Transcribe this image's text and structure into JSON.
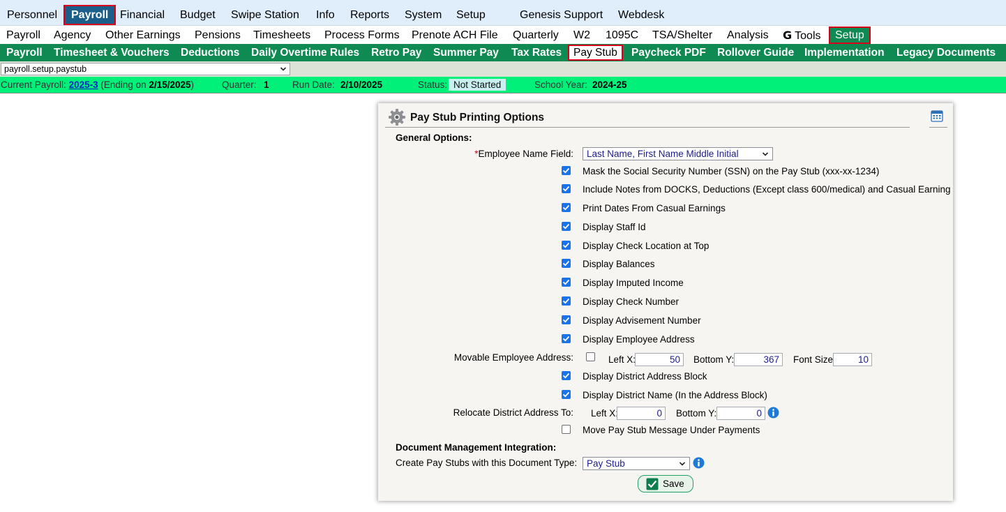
{
  "top_menu": {
    "items": [
      "Personnel",
      "Payroll",
      "Financial",
      "Budget",
      "Swipe Station",
      "Info",
      "Reports",
      "System",
      "Setup",
      "Genesis Support",
      "Webdesk"
    ],
    "active": "Payroll"
  },
  "sub_menu": {
    "items": [
      "Payroll",
      "Agency",
      "Other Earnings",
      "Pensions",
      "Timesheets",
      "Process Forms",
      "Prenote ACH File",
      "Quarterly",
      "W2",
      "1095C",
      "TSA/Shelter",
      "Analysis",
      "Tools",
      "Setup"
    ],
    "active": "Setup",
    "tools_icon": "google-g-icon"
  },
  "tab_bar": {
    "items": [
      "Payroll",
      "Timesheet & Vouchers",
      "Deductions",
      "Daily Overtime Rules",
      "Retro Pay",
      "Summer Pay",
      "Tax Rates",
      "Pay Stub",
      "Paycheck PDF",
      "Rollover Guide",
      "Implementation",
      "Legacy Documents"
    ],
    "active": "Pay Stub"
  },
  "page_selector": {
    "value": "payroll.setup.paystub"
  },
  "status": {
    "current_payroll_label": "Current Payroll:",
    "current_payroll_link": "2025-3",
    "ending_prefix": "(Ending on ",
    "ending_date": "2/15/2025",
    "ending_suffix": ")",
    "quarter_label": "Quarter:",
    "quarter_value": "1",
    "run_date_label": "Run Date:",
    "run_date_value": "2/10/2025",
    "status_label": "Status:",
    "status_value": "Not Started",
    "school_year_label": "School Year:",
    "school_year_value": "2024-25"
  },
  "panel": {
    "title": "Pay Stub Printing Options",
    "header_icon": "gear-icon",
    "corner_icon": "calendar-icon",
    "general_options_label": "General Options:",
    "employee_name_field": {
      "required_mark": "*",
      "label": "Employee Name Field:",
      "value": "Last Name, First Name Middle Initial"
    },
    "checkboxes_1": [
      {
        "label": "Mask the Social Security Number (SSN) on the Pay Stub (xxx-xx-1234)",
        "checked": true
      },
      {
        "label": "Include Notes from DOCKS, Deductions (Except class 600/medical) and Casual Earning",
        "checked": true
      },
      {
        "label": "Print Dates From Casual Earnings",
        "checked": true
      },
      {
        "label": "Display Staff Id",
        "checked": true
      },
      {
        "label": "Display Check Location at Top",
        "checked": true
      },
      {
        "label": "Display Balances",
        "checked": true
      },
      {
        "label": "Display Imputed Income",
        "checked": true
      },
      {
        "label": "Display Check Number",
        "checked": true
      },
      {
        "label": "Display Advisement Number",
        "checked": true
      },
      {
        "label": "Display Employee Address",
        "checked": true
      }
    ],
    "movable_address": {
      "label": "Movable Employee Address:",
      "checked": false,
      "left_x_label": "Left X:",
      "left_x_value": "50",
      "bottom_y_label": "Bottom Y:",
      "bottom_y_value": "367",
      "font_size_label": "Font Size:",
      "font_size_value": "10"
    },
    "checkboxes_2": [
      {
        "label": "Display District Address Block",
        "checked": true
      },
      {
        "label": "Display District Name (In the Address Block)",
        "checked": true
      }
    ],
    "relocate": {
      "label": "Relocate District Address To:",
      "left_x_label": "Left X:",
      "left_x_value": "0",
      "bottom_y_label": "Bottom Y:",
      "bottom_y_value": "0"
    },
    "move_message": {
      "label": "Move Pay Stub Message Under Payments",
      "checked": false
    },
    "doc_mgmt_label": "Document Management Integration:",
    "doc_type": {
      "label": "Create Pay Stubs with this Document Type:",
      "value": "Pay Stub"
    },
    "save_label": "Save"
  },
  "colors": {
    "top_bar": "#dfeefa",
    "active_top": "#1b5e8a",
    "tab_bar": "#0e8a52",
    "status_bar": "#00f07a",
    "highlight_border": "#d9001b",
    "checkbox": "#1a73e8"
  }
}
